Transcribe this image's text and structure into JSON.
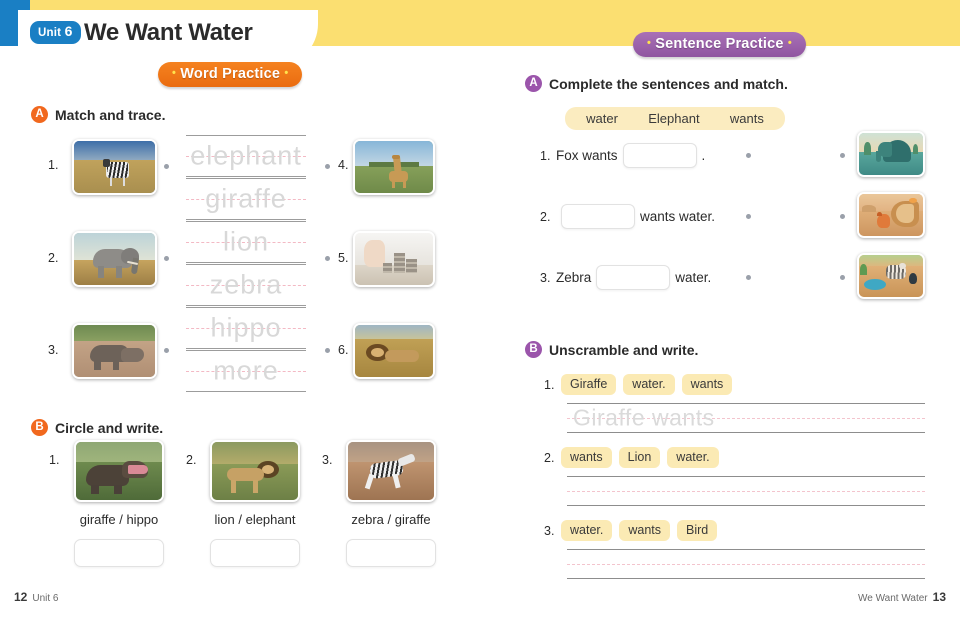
{
  "header": {
    "unit_label": "Unit",
    "unit_number": "6",
    "title": "We Want Water"
  },
  "badges": {
    "word_practice": "Word Practice",
    "sentence_practice": "Sentence Practice",
    "dot": "•"
  },
  "left_page": {
    "section_a": {
      "letter": "A",
      "title": "Match and trace.",
      "left_items": [
        {
          "num": "1.",
          "image": "zebra-photo"
        },
        {
          "num": "2.",
          "image": "elephant-photo"
        },
        {
          "num": "3.",
          "image": "hippo-photo"
        }
      ],
      "trace_words": [
        "elephant",
        "giraffe",
        "lion",
        "zebra",
        "hippo",
        "more"
      ],
      "right_items": [
        {
          "num": "4.",
          "image": "giraffe-photo"
        },
        {
          "num": "5.",
          "image": "coins-hand-photo"
        },
        {
          "num": "6.",
          "image": "lion-photo"
        }
      ]
    },
    "section_b": {
      "letter": "B",
      "title": "Circle and write.",
      "items": [
        {
          "num": "1.",
          "image": "hippo-open-mouth-photo",
          "choices": "giraffe / hippo",
          "answer": ""
        },
        {
          "num": "2.",
          "image": "lion-walking-photo",
          "choices": "lion / elephant",
          "answer": ""
        },
        {
          "num": "3.",
          "image": "zebra-running-photo",
          "choices": "zebra / giraffe",
          "answer": ""
        }
      ]
    }
  },
  "right_page": {
    "section_a": {
      "letter": "A",
      "title": "Complete the sentences and match.",
      "word_bank": [
        "water",
        "Elephant",
        "wants"
      ],
      "sentences": [
        {
          "num": "1.",
          "before": "Fox wants",
          "blank": "",
          "after": "."
        },
        {
          "num": "2.",
          "before": "",
          "blank": "",
          "after": "wants water."
        },
        {
          "num": "3.",
          "before": "Zebra",
          "blank": "",
          "after": "water."
        }
      ],
      "pictures": [
        "elephant-in-water-illustration",
        "fox-with-horn-illustration",
        "zebra-and-bird-waterhole-illustration"
      ]
    },
    "section_b": {
      "letter": "B",
      "title": "Unscramble and write.",
      "items": [
        {
          "num": "1.",
          "chips": [
            "Giraffe",
            "water.",
            "wants"
          ],
          "sample_answer": "Giraffe wants"
        },
        {
          "num": "2.",
          "chips": [
            "wants",
            "Lion",
            "water."
          ],
          "sample_answer": ""
        },
        {
          "num": "3.",
          "chips": [
            "water.",
            "wants",
            "Bird"
          ],
          "sample_answer": ""
        }
      ]
    }
  },
  "footer": {
    "left_page_number": "12",
    "left_label": "Unit 6",
    "right_label": "We Want Water",
    "right_page_number": "13"
  },
  "colors": {
    "header_yellow": "#fbdf71",
    "header_blue": "#1a7fc4",
    "orange": "#f1681e",
    "purple": "#9b55ab",
    "chip_yellow": "#fbeab4"
  }
}
